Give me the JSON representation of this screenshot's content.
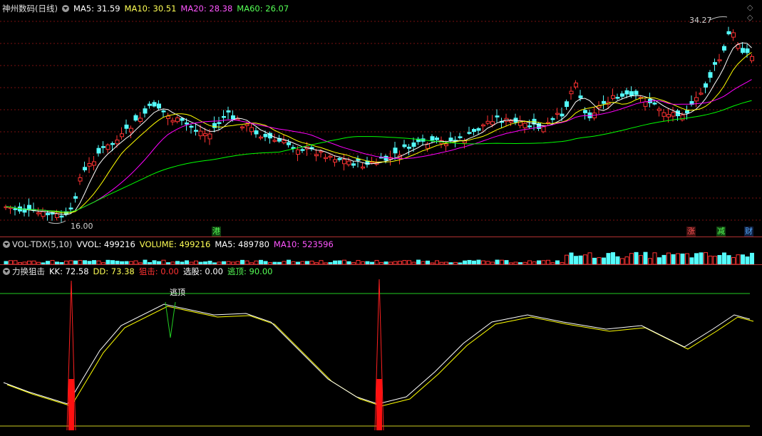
{
  "main": {
    "stock_name": "神州数码(日线)",
    "ma": [
      {
        "label": "MA5: 31.59",
        "color": "#ffffff"
      },
      {
        "label": "MA10: 30.51",
        "color": "#ffff55"
      },
      {
        "label": "MA20: 28.38",
        "color": "#ff55ff"
      },
      {
        "label": "MA60: 26.07",
        "color": "#55ff55"
      }
    ],
    "high_label": "34.27",
    "low_label": "16.00",
    "tags": {
      "gang": "港",
      "zhang": "涨",
      "jian": "减",
      "cai": "财"
    },
    "nav_up": "◇",
    "nav_left": "◇",
    "colors": {
      "up": "#ff3232",
      "down": "#54fcfc",
      "ma5": "#ffffff",
      "ma10": "#ffff00",
      "ma20": "#ff00ff",
      "ma60": "#00ff00"
    }
  },
  "vol": {
    "title": "VOL-TDX(5,10)",
    "items": [
      {
        "label": "VVOL: 499216",
        "color": "#ffffff"
      },
      {
        "label": "VOLUME: 499216",
        "color": "#ffff55"
      },
      {
        "label": "MA5: 489780",
        "color": "#ffffff"
      },
      {
        "label": "MA10: 523596",
        "color": "#ff55ff"
      }
    ]
  },
  "ind": {
    "title": "力换狙击",
    "items": [
      {
        "label": "KK: 72.58",
        "color": "#ffffff"
      },
      {
        "label": "DD: 73.38",
        "color": "#ffff55"
      },
      {
        "label": "狙击: ",
        "color": "#ff3232",
        "value": "0.00"
      },
      {
        "label": "选股: 0.00",
        "color": "#ffffff"
      },
      {
        "label": "逃顶: 90.00",
        "color": "#55ff55"
      }
    ],
    "escape_label": "逃顶"
  }
}
